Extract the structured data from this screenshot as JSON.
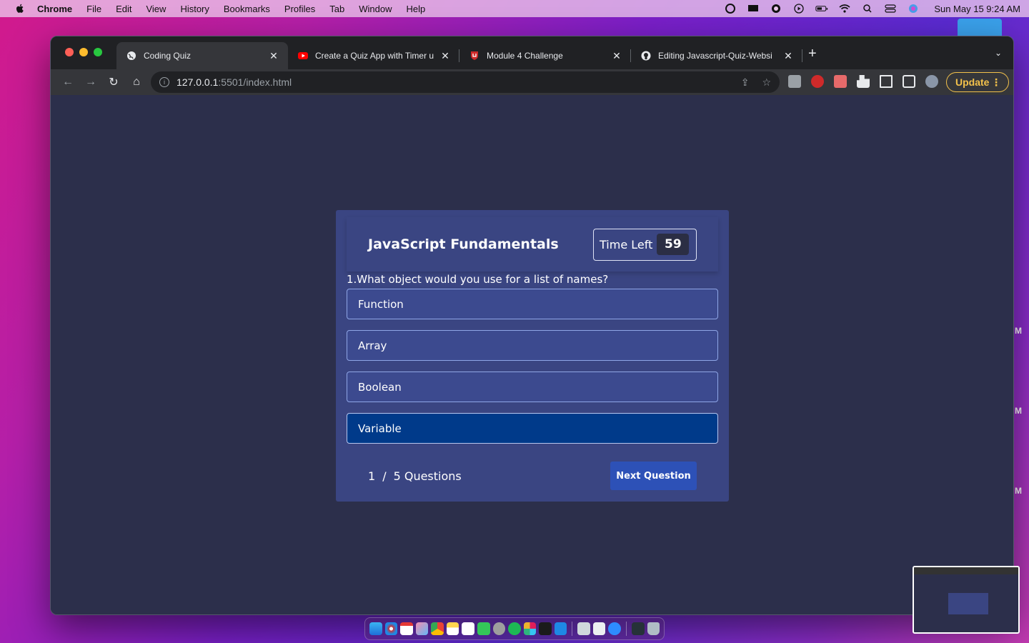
{
  "menubar": {
    "app_name": "Chrome",
    "items": [
      "File",
      "Edit",
      "View",
      "History",
      "Bookmarks",
      "Profiles",
      "Tab",
      "Window",
      "Help"
    ],
    "clock": "Sun May 15  9:24 AM"
  },
  "browser": {
    "tabs": [
      {
        "title": "Coding Quiz",
        "favicon": "globe-icon",
        "active": true
      },
      {
        "title": "Create a Quiz App with Timer u",
        "favicon": "youtube-icon",
        "active": false
      },
      {
        "title": "Module 4 Challenge",
        "favicon": "shield-icon",
        "active": false
      },
      {
        "title": "Editing Javascript-Quiz-Websi",
        "favicon": "github-icon",
        "active": false
      }
    ],
    "url_host": "127.0.0.1",
    "url_path": ":5501/index.html",
    "update_label": "Update"
  },
  "quiz": {
    "title": "JavaScript Fundamentals",
    "timer_label": "Time Left",
    "timer_value": "59",
    "question": "1.What object would you use for a list of names?",
    "options": [
      "Function",
      "Array",
      "Boolean",
      "Variable"
    ],
    "selected_option": "Variable",
    "counter_current": "1",
    "counter_sep": "/",
    "counter_total": "5 Questions",
    "next_label": "Next Question"
  },
  "colors": {
    "page_bg": "#2c2f4b",
    "card_bg": "#3a4582",
    "selected_bg": "#003a8a",
    "button_bg": "#2d51b7",
    "update_accent": "#f2c14b"
  },
  "desktop": {
    "side_letters": [
      "M",
      "M",
      "M"
    ]
  }
}
